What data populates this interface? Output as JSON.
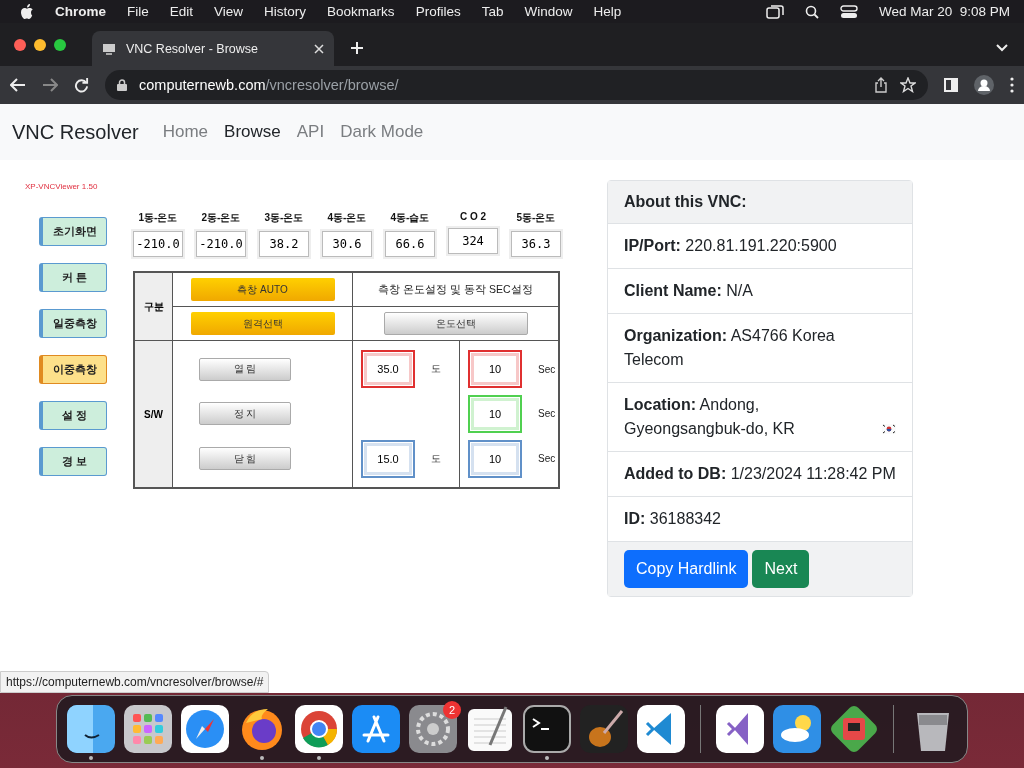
{
  "menubar": {
    "app": "Chrome",
    "menus": [
      "File",
      "Edit",
      "View",
      "History",
      "Bookmarks",
      "Profiles",
      "Tab",
      "Window",
      "Help"
    ],
    "clock": "Wed Mar 20  9:08 PM"
  },
  "browser": {
    "tab_title": "VNC Resolver - Browse",
    "url_host": "computernewb.com",
    "url_path": "/vncresolver/browse/"
  },
  "navbar": {
    "brand": "VNC Resolver",
    "links": [
      {
        "label": "Home",
        "selected": false
      },
      {
        "label": "Browse",
        "selected": true
      },
      {
        "label": "API",
        "selected": false
      },
      {
        "label": "Dark Mode",
        "selected": false
      }
    ]
  },
  "vnc_screen": {
    "viewer_title": "XP-VNCViewer 1.50",
    "side_buttons": [
      {
        "label": "초기화면",
        "selected": false
      },
      {
        "label": "커 튼",
        "selected": false
      },
      {
        "label": "일중측창",
        "selected": false
      },
      {
        "label": "이중측창",
        "selected": true
      },
      {
        "label": "설 정",
        "selected": false
      },
      {
        "label": "경 보",
        "selected": false
      }
    ],
    "sensors": [
      {
        "label": "1동-온도",
        "value": "-210.0"
      },
      {
        "label": "2동-온도",
        "value": "-210.0"
      },
      {
        "label": "3동-온도",
        "value": "38.2"
      },
      {
        "label": "4동-온도",
        "value": "30.6"
      },
      {
        "label": "4동-습도",
        "value": "66.6"
      },
      {
        "label": "C O 2",
        "value": "324"
      },
      {
        "label": "5동-온도",
        "value": "36.3"
      }
    ],
    "header_label": "구분",
    "auto_button": "측창 AUTO",
    "remote_button": "원격선택",
    "settings_title": "측창 온도설정 및 동작 SEC설정",
    "temp_select_button": "온도선택",
    "sw_label": "S/W",
    "sw_rows": [
      {
        "button": "열 림",
        "temp": {
          "value": "35.0",
          "color": "#e03030",
          "unit": "도"
        },
        "sec": {
          "value": "10",
          "color": "#e03030",
          "unit": "Sec"
        }
      },
      {
        "button": "정 지",
        "sec": {
          "value": "10",
          "color": "#50d050",
          "unit": "Sec"
        }
      },
      {
        "button": "닫 힘",
        "temp": {
          "value": "15.0",
          "color": "#6090c8",
          "unit": "도"
        },
        "sec": {
          "value": "10",
          "color": "#6090c8",
          "unit": "Sec"
        }
      }
    ]
  },
  "about": {
    "heading": "About this VNC:",
    "rows": [
      {
        "label": "IP/Port:",
        "value": "220.81.191.220:5900"
      },
      {
        "label": "Client Name:",
        "value": "N/A"
      },
      {
        "label": "Organization:",
        "value": "AS4766 Korea Telecom"
      },
      {
        "label": "Location:",
        "value": "Andong, Gyeongsangbuk-do, KR",
        "flag": true
      },
      {
        "label": "Added to DB:",
        "value": "1/23/2024 11:28:42 PM"
      },
      {
        "label": "ID:",
        "value": "36188342"
      }
    ],
    "buttons": [
      {
        "label": "Copy Hardlink",
        "kind": "primary"
      },
      {
        "label": "Next",
        "kind": "success"
      }
    ]
  },
  "status_url": "https://computernewb.com/vncresolver/browse/#",
  "dock": [
    {
      "kind": "finder",
      "running": true
    },
    {
      "kind": "grid",
      "running": false
    },
    {
      "kind": "compass",
      "running": false
    },
    {
      "kind": "fox",
      "running": true
    },
    {
      "kind": "ring",
      "running": true
    },
    {
      "kind": "store",
      "running": false
    },
    {
      "kind": "gear",
      "running": false,
      "badge": "2"
    },
    {
      "kind": "notepad",
      "running": false
    },
    {
      "kind": "terminal",
      "running": true
    },
    {
      "kind": "guitar",
      "running": false
    },
    {
      "kind": "code",
      "running": false
    },
    {
      "kind": "sep"
    },
    {
      "kind": "studio",
      "running": false
    },
    {
      "kind": "weather",
      "running": false
    },
    {
      "kind": "melon",
      "running": false
    },
    {
      "kind": "sep"
    },
    {
      "kind": "trash",
      "running": false
    }
  ]
}
